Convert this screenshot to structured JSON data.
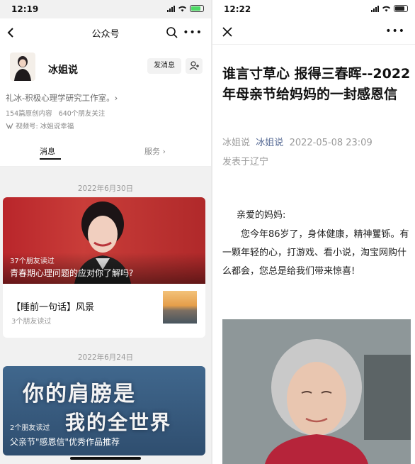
{
  "left": {
    "status": {
      "time": "12:19"
    },
    "nav": {
      "title": "公众号"
    },
    "profile": {
      "name": "冰姐说",
      "message_button": "发消息",
      "description": "礼冰-积极心理学研究工作室。›",
      "original_count": "154篇原创内容",
      "friends_follow": "640个朋友关注",
      "video_label": "视频号:",
      "video_name": "冰姐说幸福"
    },
    "tabs": [
      "消息",
      "服务 ›"
    ],
    "feed": [
      {
        "date": "2022年6月30日",
        "readers": "37个朋友读过",
        "title": "青春期心理问题的应对你了解吗?",
        "sub_title": "【睡前一句话】风景",
        "sub_readers": "3个朋友读过"
      },
      {
        "date": "2022年6月24日",
        "banner_line1": "你的肩膀是",
        "banner_line2": "我的全世界",
        "readers": "2个朋友读过",
        "title": "父亲节\"感恩信\"优秀作品推荐"
      }
    ]
  },
  "right": {
    "status": {
      "time": "12:22"
    },
    "article": {
      "title": "谁言寸草心 报得三春晖--2022年母亲节给妈妈的一封感恩信",
      "author": "冰姐说",
      "account": "冰姐说",
      "datetime": "2022-05-08 23:09",
      "location": "发表于辽宁",
      "greeting": "亲爱的妈妈:",
      "paragraph": "您今年86岁了，身体健康，精神矍铄。有一颗年轻的心，打游戏、看小说，淘宝网购什么都会，您总是给我们带来惊喜!"
    }
  },
  "colors": {
    "link": "#576b95",
    "banner_red": "#b9262b",
    "banner_blue": "#40678d"
  }
}
